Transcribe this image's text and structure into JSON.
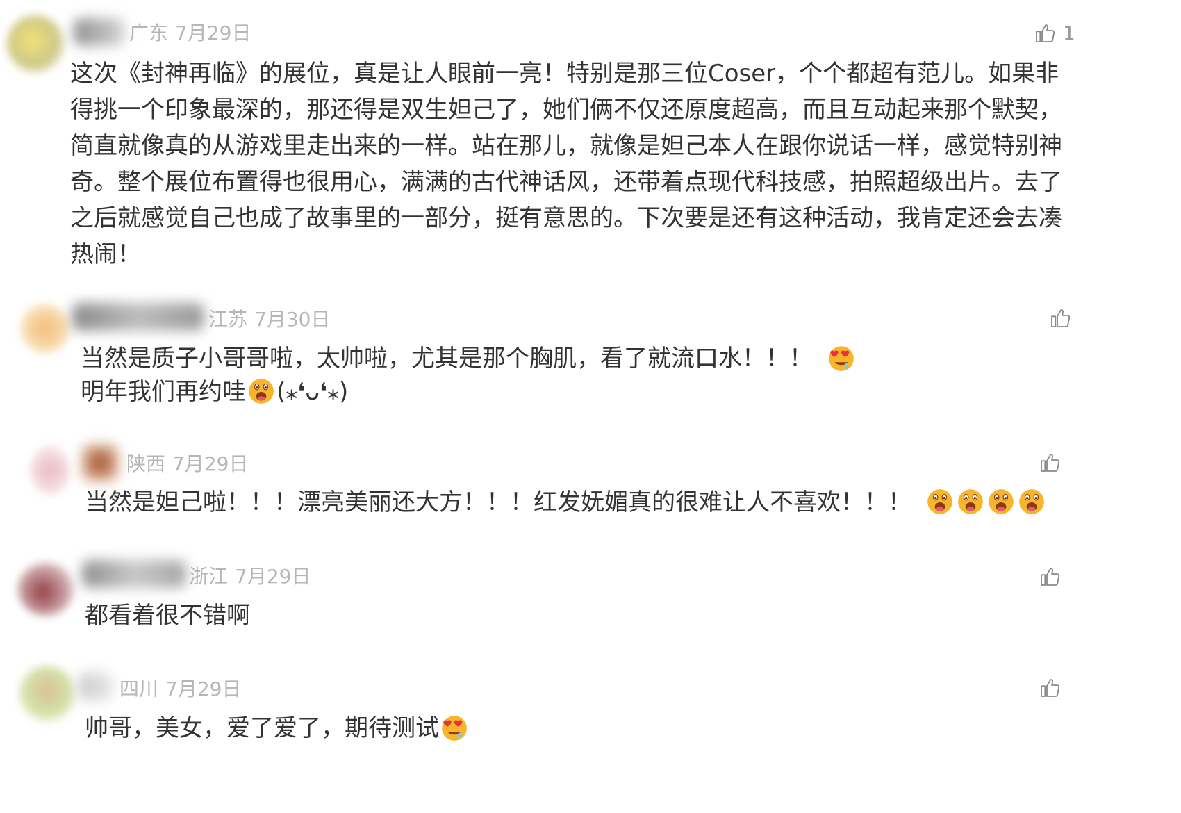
{
  "comments": [
    {
      "location": "广东",
      "date": "7月29日",
      "likes": "1",
      "text": "这次《封神再临》的展位，真是让人眼前一亮！特别是那三位Coser，个个都超有范儿。如果非得挑一个印象最深的，那还得是双生妲己了，她们俩不仅还原度超高，而且互动起来那个默契，简直就像真的从游戏里走出来的一样。站在那儿，就像是妲己本人在跟你说话一样，感觉特别神奇。整个展位布置得也很用心，满满的古代神话风，还带着点现代科技感，拍照超级出片。去了之后就感觉自己也成了故事里的一部分，挺有意思的。下次要是还有这种活动，我肯定还会去凑热闹！"
    },
    {
      "location": "江苏",
      "date": "7月30日",
      "line1": "当然是质子小哥哥啦，太帅啦，尤其是那个胸肌，看了就流口水！！！",
      "line2": "明年我们再约哇",
      "kaomoji": "(⁎❛ᴗ❛⁎)"
    },
    {
      "location": "陕西",
      "date": "7月29日",
      "text": "当然是妲己啦！！！漂亮美丽还大方！！！红发妩媚真的很难让人不喜欢！！！"
    },
    {
      "location": "浙江",
      "date": "7月29日",
      "text": "都看着很不错啊"
    },
    {
      "location": "四川",
      "date": "7月29日",
      "text": "帅哥，美女，爱了爱了，期待测试"
    }
  ],
  "icons": {
    "like": "thumbs-up-icon",
    "heart_eyes": "heart-eyes-emoji",
    "drooling": "drooling-emoji"
  },
  "colors": {
    "text": "#333333",
    "meta": "#b6b6b6",
    "emoji": "#f7b52c"
  }
}
